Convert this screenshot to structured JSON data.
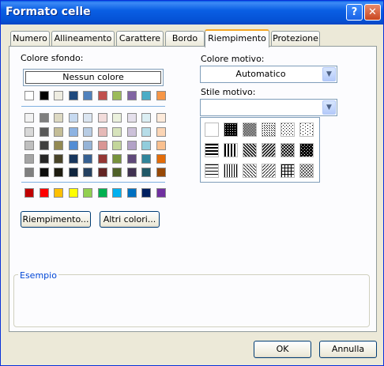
{
  "window": {
    "title": "Formato celle",
    "help_glyph": "?",
    "close_glyph": "✕"
  },
  "tabs": [
    {
      "label": "Numero",
      "active": false
    },
    {
      "label": "Allineamento",
      "active": false
    },
    {
      "label": "Carattere",
      "active": false
    },
    {
      "label": "Bordo",
      "active": false
    },
    {
      "label": "Riempimento",
      "active": true
    },
    {
      "label": "Protezione",
      "active": false
    }
  ],
  "left": {
    "background_color_label": "Colore sfondo:",
    "no_color_label": "Nessun colore",
    "fill_effects_label": "Riempimento...",
    "more_colors_label": "Altri colori...",
    "swatch_rows": [
      [
        "#ffffff",
        "#000000",
        "#eeece1",
        "#1f497d",
        "#4f81bd",
        "#c0504d",
        "#9bbb59",
        "#8064a2",
        "#4bacc6",
        "#f79646"
      ],
      [
        "#f2f2f2",
        "#7f7f7f",
        "#ddd9c3",
        "#c6d9f0",
        "#dbe5f1",
        "#f2dcdb",
        "#ebf1dd",
        "#e5e0ec",
        "#dbeef3",
        "#fdeada"
      ],
      [
        "#d8d8d8",
        "#595959",
        "#c4bd97",
        "#8db3e2",
        "#b8cce4",
        "#e5b9b7",
        "#d7e3bc",
        "#ccc1d9",
        "#b7dde8",
        "#fbd5b5"
      ],
      [
        "#bfbfbf",
        "#3f3f3f",
        "#938953",
        "#548dd4",
        "#95b3d7",
        "#d99694",
        "#c3d69b",
        "#b2a2c7",
        "#92cddc",
        "#fac08f"
      ],
      [
        "#a5a5a5",
        "#262626",
        "#494429",
        "#17365d",
        "#366092",
        "#953734",
        "#76923c",
        "#5f497a",
        "#31859b",
        "#e36c09"
      ],
      [
        "#7f7f7f",
        "#0c0c0c",
        "#1d1b10",
        "#0f243e",
        "#244061",
        "#632423",
        "#4f6128",
        "#3f3151",
        "#205867",
        "#974806"
      ],
      [
        "#c00000",
        "#ff0000",
        "#ffc000",
        "#ffff00",
        "#92d050",
        "#00b050",
        "#00b0f0",
        "#0070c0",
        "#002060",
        "#7030a0"
      ]
    ]
  },
  "right": {
    "pattern_color_label": "Colore motivo:",
    "pattern_color_value": "Automatico",
    "pattern_style_label": "Stile motivo:",
    "pattern_style_value": "",
    "arrow_glyph": "▼",
    "patterns": [
      "solid-white",
      "dense-75",
      "dense-50",
      "dense-25",
      "dense-12",
      "dense-6",
      "horizontal",
      "vertical",
      "diagonal-down",
      "diagonal-up",
      "diagonal-cross",
      "thick-diagonal-cross",
      "thin-horizontal",
      "thin-vertical",
      "thin-diagonal-down",
      "thin-diagonal-up",
      "thin-grid",
      "thin-diagonal-cross"
    ]
  },
  "sample": {
    "label": "Esempio"
  },
  "footer": {
    "ok_label": "OK",
    "cancel_label": "Annulla"
  }
}
